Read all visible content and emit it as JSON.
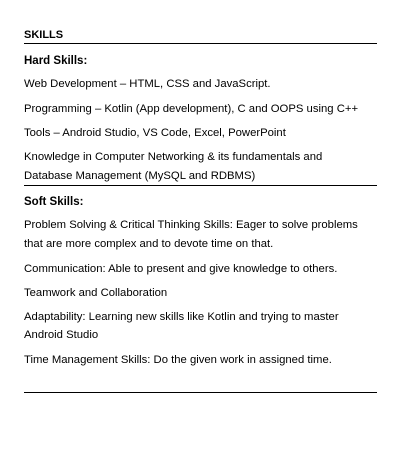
{
  "section_title": "SKILLS",
  "hard_skills": {
    "heading": "Hard Skills:",
    "items": [
      "Web Development – HTML, CSS and JavaScript.",
      "Programming – Kotlin (App development), C and OOPS using C++",
      "Tools – Android Studio, VS Code, Excel, PowerPoint",
      "Knowledge in Computer Networking & its fundamentals and",
      "Database Management (MySQL and RDBMS)"
    ]
  },
  "soft_skills": {
    "heading": "Soft Skills:",
    "items": [
      "Problem Solving & Critical Thinking Skills: Eager to solve problems",
      "that are more complex and to devote time on that.",
      "Communication: Able to present and give knowledge to others.",
      "Teamwork and Collaboration",
      "Adaptability: Learning new skills like Kotlin and trying to master",
      "Android Studio",
      "Time Management Skills: Do the given work in assigned time."
    ]
  }
}
